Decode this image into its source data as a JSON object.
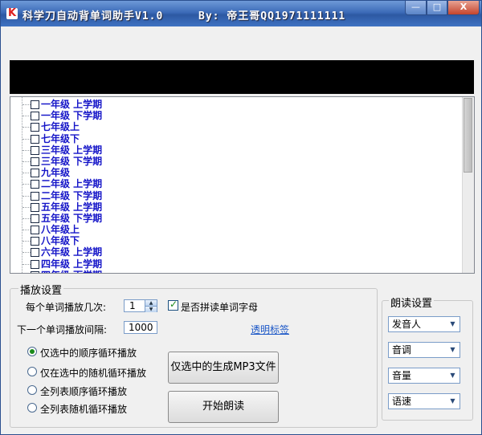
{
  "window": {
    "title": "科学刀自动背单词助手V1.0",
    "author": "By: 帝王哥QQ1971111111",
    "icon_letter": "K",
    "minimize_glyph": "—",
    "maximize_glyph": "□",
    "close_glyph": "X"
  },
  "tree": {
    "items": [
      {
        "label": "一年级 上学期"
      },
      {
        "label": "一年级 下学期"
      },
      {
        "label": "七年级上"
      },
      {
        "label": "七年级下"
      },
      {
        "label": "三年级 上学期"
      },
      {
        "label": "三年级 下学期"
      },
      {
        "label": "九年级"
      },
      {
        "label": "二年级 上学期"
      },
      {
        "label": "二年级 下学期"
      },
      {
        "label": "五年级 上学期"
      },
      {
        "label": "五年级 下学期"
      },
      {
        "label": "八年级上"
      },
      {
        "label": "八年级下"
      },
      {
        "label": "六年级 上学期"
      },
      {
        "label": "四年级 上学期"
      },
      {
        "label": "四年级 下学期"
      }
    ]
  },
  "playback": {
    "group_title": "播放设置",
    "repeat_label": "每个单词播放几次:",
    "repeat_value": "1",
    "interval_label": "下一个单词播放间隔:",
    "interval_value": "1000",
    "spell_letters_label": "是否拼读单词字母",
    "spell_letters_checked": true,
    "transparent_link": "透明标签",
    "modes": [
      {
        "label": "仅选中的顺序循环播放",
        "selected": true
      },
      {
        "label": "仅在选中的随机循环播放",
        "selected": false
      },
      {
        "label": "全列表顺序循环播放",
        "selected": false
      },
      {
        "label": "全列表随机循环播放",
        "selected": false
      }
    ],
    "generate_mp3_label": "仅选中的生成MP3文件",
    "start_label": "开始朗读"
  },
  "reading": {
    "group_title": "朗读设置",
    "voice_placeholder": "发音人",
    "pitch_placeholder": "音调",
    "volume_placeholder": "音量",
    "speed_placeholder": "语速"
  }
}
